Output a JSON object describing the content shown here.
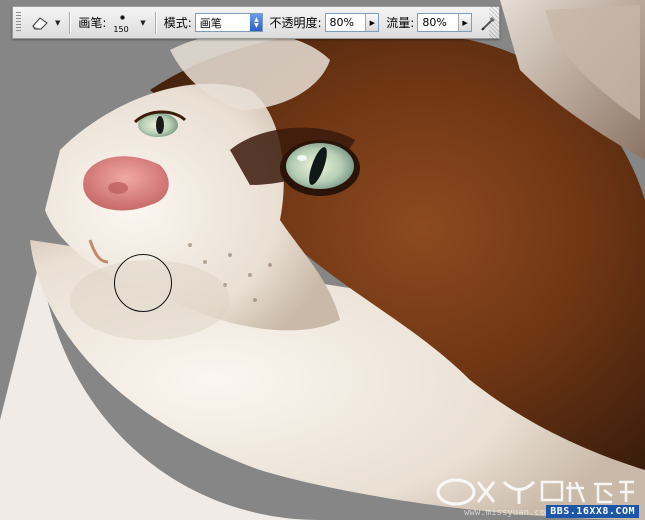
{
  "options_bar": {
    "brush_label": "画笔:",
    "brush_size": "150",
    "mode_label": "模式:",
    "mode_value": "画笔",
    "opacity_label": "不透明度:",
    "opacity_value": "80%",
    "flow_label": "流量:",
    "flow_value": "80%"
  },
  "watermark": {
    "logo_text": "OX思缘论坛",
    "url": "BBS.16XX8.COM",
    "faint_url": "www.missyuan.com"
  },
  "colors": {
    "background_gray": "#878787",
    "fur_brown": "#7a3a16",
    "fur_white": "#f2ece6",
    "eye_green": "#cfe0c5",
    "nose_pink": "#e38c8c"
  }
}
